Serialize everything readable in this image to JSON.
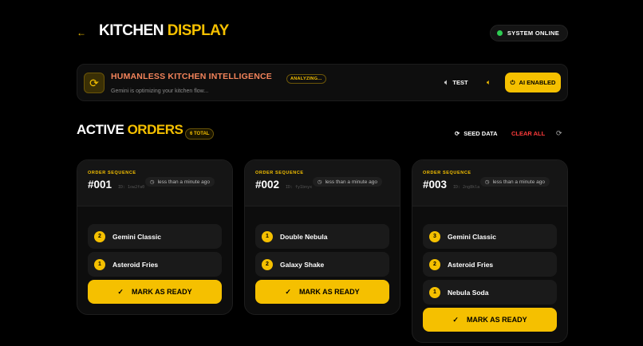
{
  "header": {
    "title_main": "KITCHEN",
    "title_accent": "DISPLAY",
    "status": "SYSTEM ONLINE",
    "back_icon": "←"
  },
  "banner": {
    "title": "HUMANLESS KITCHEN INTELLIGENCE",
    "badge": "ANALYZING...",
    "subtitle": "Gemini is optimizing your kitchen flow...",
    "test_label": "TEST",
    "ai_label": "AI ENABLED"
  },
  "orders": {
    "title_main": "ACTIVE",
    "title_accent": "ORDERS",
    "total": "6 TOTAL",
    "seed_label": "SEED DATA",
    "clear_label": "CLEAR ALL",
    "seq_label": "ORDER SEQUENCE",
    "ready_label": "MARK AS READY",
    "list": [
      {
        "number": "#001",
        "id": "ID: 1ow2fa0",
        "time": "less than a minute ago",
        "items": [
          {
            "qty": "2",
            "name": "Gemini Classic"
          },
          {
            "qty": "1",
            "name": "Asteroid Fries"
          }
        ]
      },
      {
        "number": "#002",
        "id": "ID: fy1bnyx",
        "time": "less than a minute ago",
        "items": [
          {
            "qty": "1",
            "name": "Double Nebula"
          },
          {
            "qty": "2",
            "name": "Galaxy Shake"
          }
        ]
      },
      {
        "number": "#003",
        "id": "ID: 2ng8kla",
        "time": "less than a minute ago",
        "items": [
          {
            "qty": "3",
            "name": "Gemini Classic"
          },
          {
            "qty": "2",
            "name": "Asteroid Fries"
          },
          {
            "qty": "1",
            "name": "Nebula Soda"
          }
        ]
      }
    ]
  },
  "colors": {
    "accent": "#f5c000",
    "danger": "#ff3b3b",
    "online": "#2ecc52",
    "banner_title": "#f2835a"
  }
}
